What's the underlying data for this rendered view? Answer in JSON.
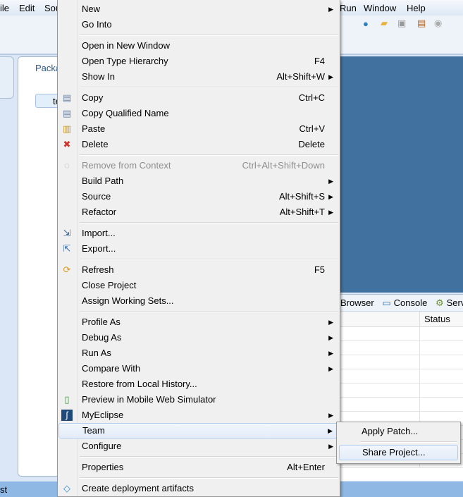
{
  "menubar": {
    "items": [
      "ile",
      "Edit",
      "Sou",
      "Run",
      "Window",
      "Help"
    ]
  },
  "package_explorer": {
    "title": "Packa",
    "tree_item": "te"
  },
  "bottom_panel": {
    "tabs": [
      "Browser",
      "Console",
      "Serve"
    ],
    "column_status": "Status"
  },
  "status_bar": {
    "text": "st"
  },
  "context_menu": {
    "items": [
      {
        "label": "New",
        "arrow": true
      },
      {
        "label": "Go Into"
      },
      {
        "sep": true
      },
      {
        "label": "Open in New Window"
      },
      {
        "label": "Open Type Hierarchy",
        "shortcut": "F4"
      },
      {
        "label": "Show In",
        "shortcut": "Alt+Shift+W",
        "arrow": true
      },
      {
        "sep": true
      },
      {
        "label": "Copy",
        "shortcut": "Ctrl+C",
        "icon": "copy-icon"
      },
      {
        "label": "Copy Qualified Name",
        "icon": "copy-qualified-icon"
      },
      {
        "label": "Paste",
        "shortcut": "Ctrl+V",
        "icon": "paste-icon"
      },
      {
        "label": "Delete",
        "shortcut": "Delete",
        "icon": "delete-icon"
      },
      {
        "sep": true
      },
      {
        "label": "Remove from Context",
        "shortcut": "Ctrl+Alt+Shift+Down",
        "disabled": true,
        "icon": "remove-context-icon"
      },
      {
        "label": "Build Path",
        "arrow": true
      },
      {
        "label": "Source",
        "shortcut": "Alt+Shift+S",
        "arrow": true
      },
      {
        "label": "Refactor",
        "shortcut": "Alt+Shift+T",
        "arrow": true
      },
      {
        "sep": true
      },
      {
        "label": "Import...",
        "icon": "import-icon"
      },
      {
        "label": "Export...",
        "icon": "export-icon"
      },
      {
        "sep": true
      },
      {
        "label": "Refresh",
        "shortcut": "F5",
        "icon": "refresh-icon"
      },
      {
        "label": "Close Project"
      },
      {
        "label": "Assign Working Sets..."
      },
      {
        "sep": true
      },
      {
        "label": "Profile As",
        "arrow": true
      },
      {
        "label": "Debug As",
        "arrow": true
      },
      {
        "label": "Run As",
        "arrow": true
      },
      {
        "label": "Compare With",
        "arrow": true
      },
      {
        "label": "Restore from Local History..."
      },
      {
        "label": "Preview in Mobile Web Simulator",
        "icon": "mobile-simulator-icon"
      },
      {
        "label": "MyEclipse",
        "arrow": true,
        "icon": "myeclipse-icon"
      },
      {
        "label": "Team",
        "arrow": true,
        "highlighted": true
      },
      {
        "label": "Configure",
        "arrow": true
      },
      {
        "sep": true
      },
      {
        "label": "Properties",
        "shortcut": "Alt+Enter"
      },
      {
        "sep": true
      },
      {
        "label": "Create deployment artifacts",
        "icon": "deployment-icon"
      }
    ]
  },
  "team_submenu": {
    "items": [
      {
        "label": "Apply Patch..."
      },
      {
        "sep": true
      },
      {
        "label": "Share Project...",
        "highlighted": true
      }
    ]
  },
  "colors": {
    "editor": "#41719f",
    "status_bar": "#8fb8e4",
    "delete_icon": "#d0332a"
  }
}
